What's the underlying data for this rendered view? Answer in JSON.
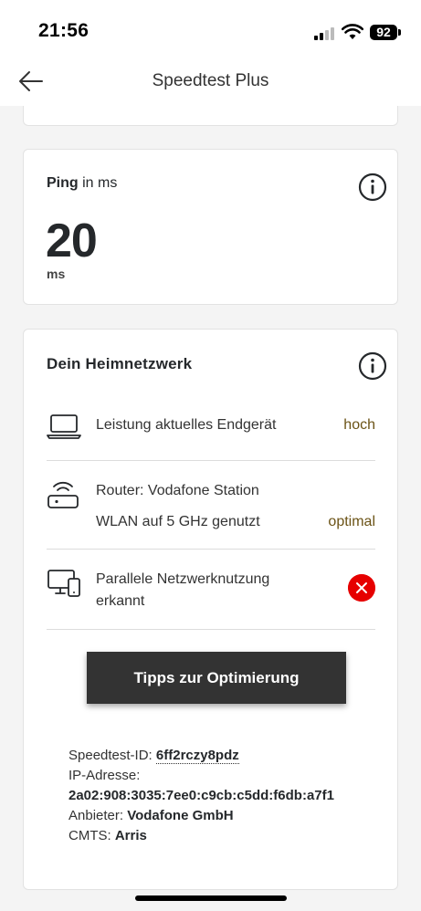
{
  "status_bar": {
    "time": "21:56",
    "battery": "92"
  },
  "header": {
    "title": "Speedtest Plus"
  },
  "ping_card": {
    "label_bold": "Ping",
    "label_rest": " in ms",
    "value": "20",
    "unit": "ms"
  },
  "network_card": {
    "title": "Dein Heimnetzwerk",
    "device": {
      "label": "Leistung aktuelles Endgerät",
      "value": "hoch"
    },
    "router": {
      "label": "Router: Vodafone Station",
      "wlan_label": "WLAN auf 5 GHz genutzt",
      "wlan_value": "optimal"
    },
    "parallel": {
      "label_line1": "Parallele Netzwerknutzung",
      "label_line2": "erkannt"
    },
    "button_label": "Tipps zur Optimierung"
  },
  "details": {
    "speedtest_id_label": "Speedtest-ID: ",
    "speedtest_id": "6ff2rczy8pdz",
    "ip_label": "IP-Adresse:",
    "ip": "2a02:908:3035:7ee0:c9cb:c5dd:f6db:a7f1",
    "provider_label": "Anbieter: ",
    "provider": "Vodafone GmbH",
    "cmts_label": "CMTS: ",
    "cmts": "Arris"
  },
  "colors": {
    "error_red": "#e60000",
    "value_brown": "#6b5316",
    "button_dark": "#333333"
  }
}
